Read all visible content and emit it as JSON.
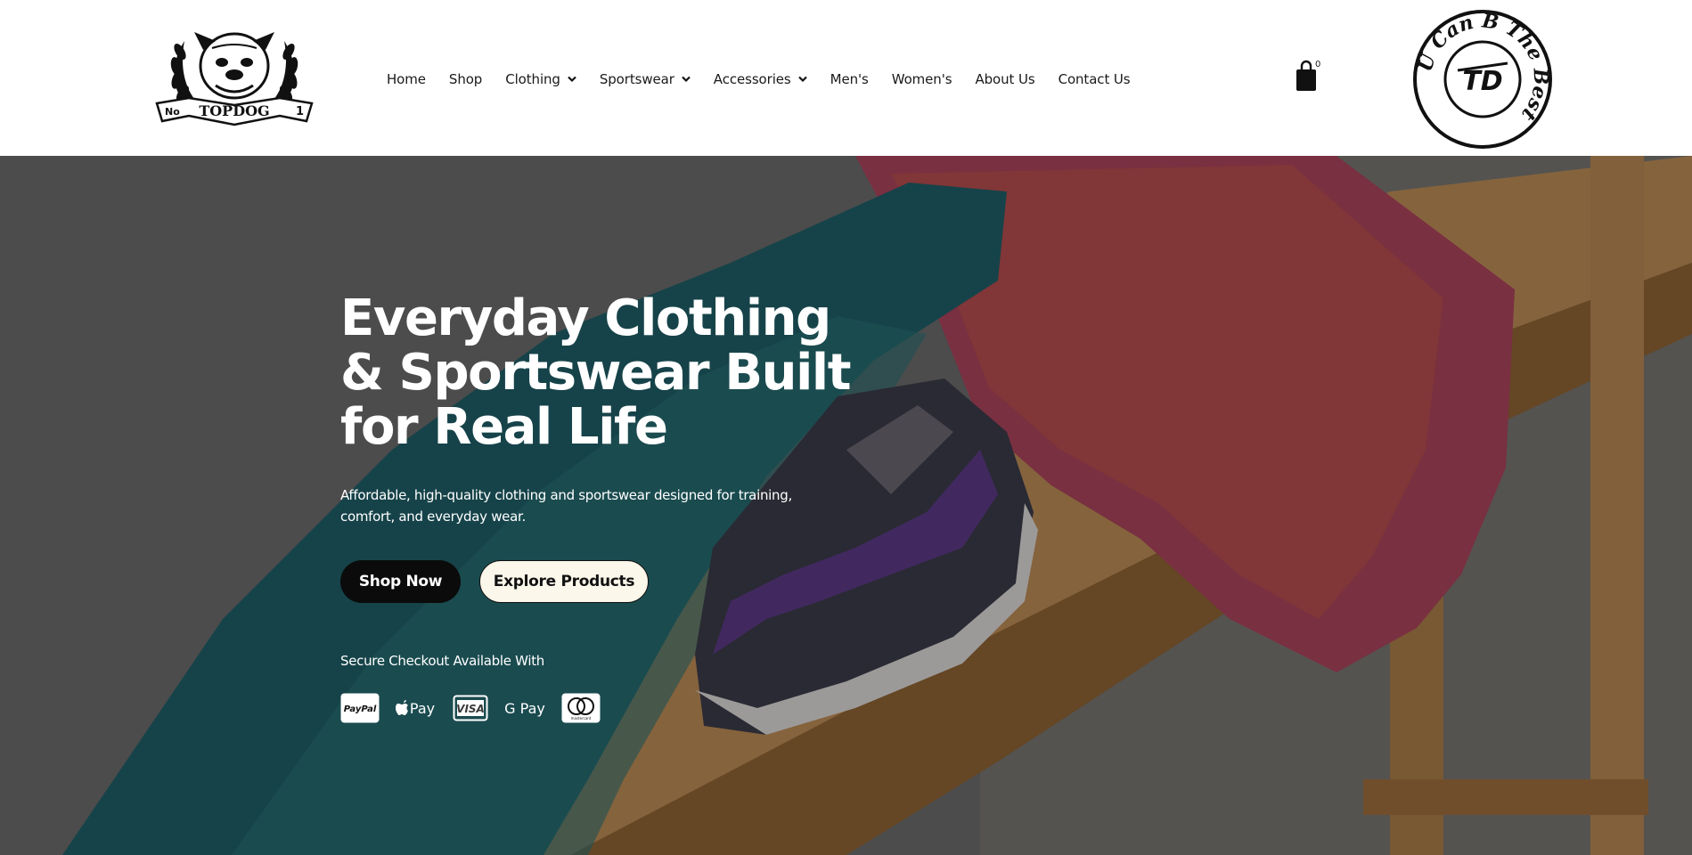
{
  "header": {
    "logo_alt": "No 1 TOPDOG logo",
    "logo_text": "TOPDOG",
    "logo_no": "No",
    "logo_num": "1",
    "nav": [
      {
        "label": "Home",
        "dropdown": false
      },
      {
        "label": "Shop",
        "dropdown": false
      },
      {
        "label": "Clothing",
        "dropdown": true
      },
      {
        "label": "Sportswear",
        "dropdown": true
      },
      {
        "label": "Accessories",
        "dropdown": true
      },
      {
        "label": "Men's",
        "dropdown": false
      },
      {
        "label": "Women's",
        "dropdown": false
      },
      {
        "label": "About Us",
        "dropdown": false
      },
      {
        "label": "Contact Us",
        "dropdown": false
      }
    ],
    "cart_count": "0",
    "badge": {
      "monogram": "TD",
      "ring_text": "U Can B The Best"
    }
  },
  "hero": {
    "title": "Everyday Clothing & Sportswear Built for Real Life",
    "subtitle": "Affordable, high-quality clothing and sportswear designed for training, comfort, and everyday wear.",
    "primary_button": "Shop Now",
    "secondary_button": "Explore Products",
    "secure_text": "Secure Checkout Available With",
    "payments": [
      "PayPal",
      "Apple Pay",
      "VISA",
      "G Pay",
      "mastercard"
    ]
  },
  "colors": {
    "header_bg": "#ffffff",
    "button_primary": "#0b0b0b",
    "button_secondary": "#fbf7ea",
    "hero_text": "#ffffff"
  },
  "icons": [
    "cart-icon",
    "chevron-down-icon",
    "paypal-icon",
    "apple-pay-icon",
    "visa-icon",
    "google-pay-icon",
    "mastercard-icon"
  ]
}
